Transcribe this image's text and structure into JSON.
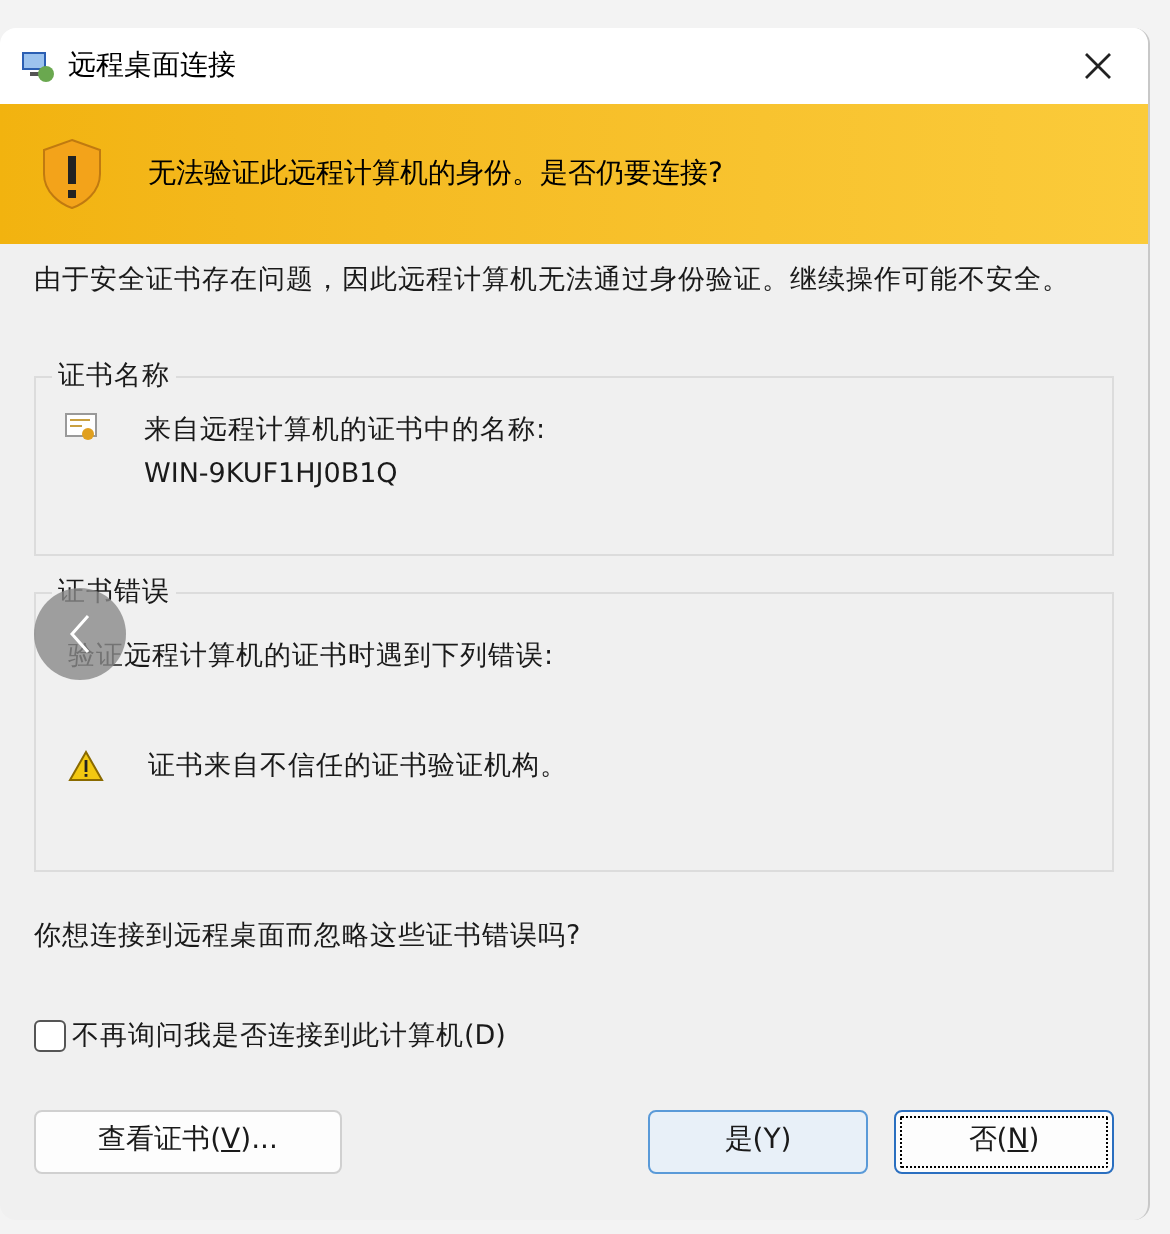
{
  "window": {
    "title": "远程桌面连接"
  },
  "banner": {
    "text": "无法验证此远程计算机的身份。是否仍要连接?"
  },
  "intro": "由于安全证书存在问题，因此远程计算机无法通过身份验证。继续操作可能不安全。",
  "cert_name": {
    "legend": "证书名称",
    "label": "来自远程计算机的证书中的名称:",
    "value": "WIN-9KUF1HJ0B1Q"
  },
  "cert_errors": {
    "legend": "证书错误",
    "intro": "验证远程计算机的证书时遇到下列错误:",
    "errors": [
      "证书来自不信任的证书验证机构。"
    ]
  },
  "question": "你想连接到远程桌面而忽略这些证书错误吗?",
  "checkbox": {
    "label": "不再询问我是否连接到此计算机(D)",
    "checked": false
  },
  "buttons": [
    {
      "before": "查看证书(",
      "key": "V",
      "after": ")...",
      "kind": "plain"
    },
    {
      "before": "是(",
      "key": "Y",
      "after": ")",
      "kind": "hover",
      "underline": false
    },
    {
      "before": "否(",
      "key": "N",
      "after": ")",
      "kind": "focus"
    }
  ]
}
